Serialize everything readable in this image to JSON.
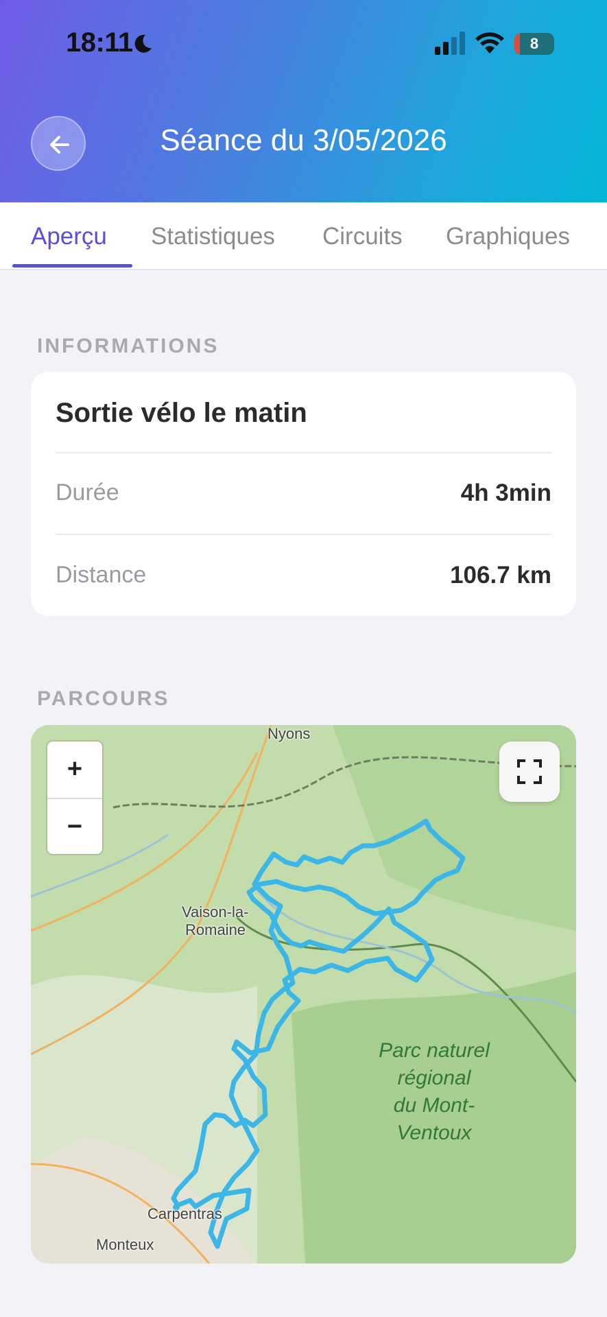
{
  "status_bar": {
    "time": "18:11",
    "battery": "8"
  },
  "header": {
    "title": "Séance du 3/05/2026"
  },
  "tabs": [
    {
      "label": "Aperçu"
    },
    {
      "label": "Statistiques"
    },
    {
      "label": "Circuits"
    },
    {
      "label": "Graphiques"
    }
  ],
  "info": {
    "section_label": "INFORMATIONS",
    "title": "Sortie vélo le matin",
    "rows": [
      {
        "label": "Durée",
        "value": "4h 3min"
      },
      {
        "label": "Distance",
        "value": "106.7 km"
      }
    ]
  },
  "route": {
    "section_label": "PARCOURS",
    "zoom_in": "+",
    "zoom_out": "−",
    "places": [
      "Nyons",
      "Vaison-la-",
      "Romaine",
      "Carpentras",
      "Monteux"
    ],
    "park_lines": [
      "Parc naturel",
      "régional",
      "du Mont-",
      "Ventoux"
    ],
    "route_color": "#3bb6e6"
  }
}
